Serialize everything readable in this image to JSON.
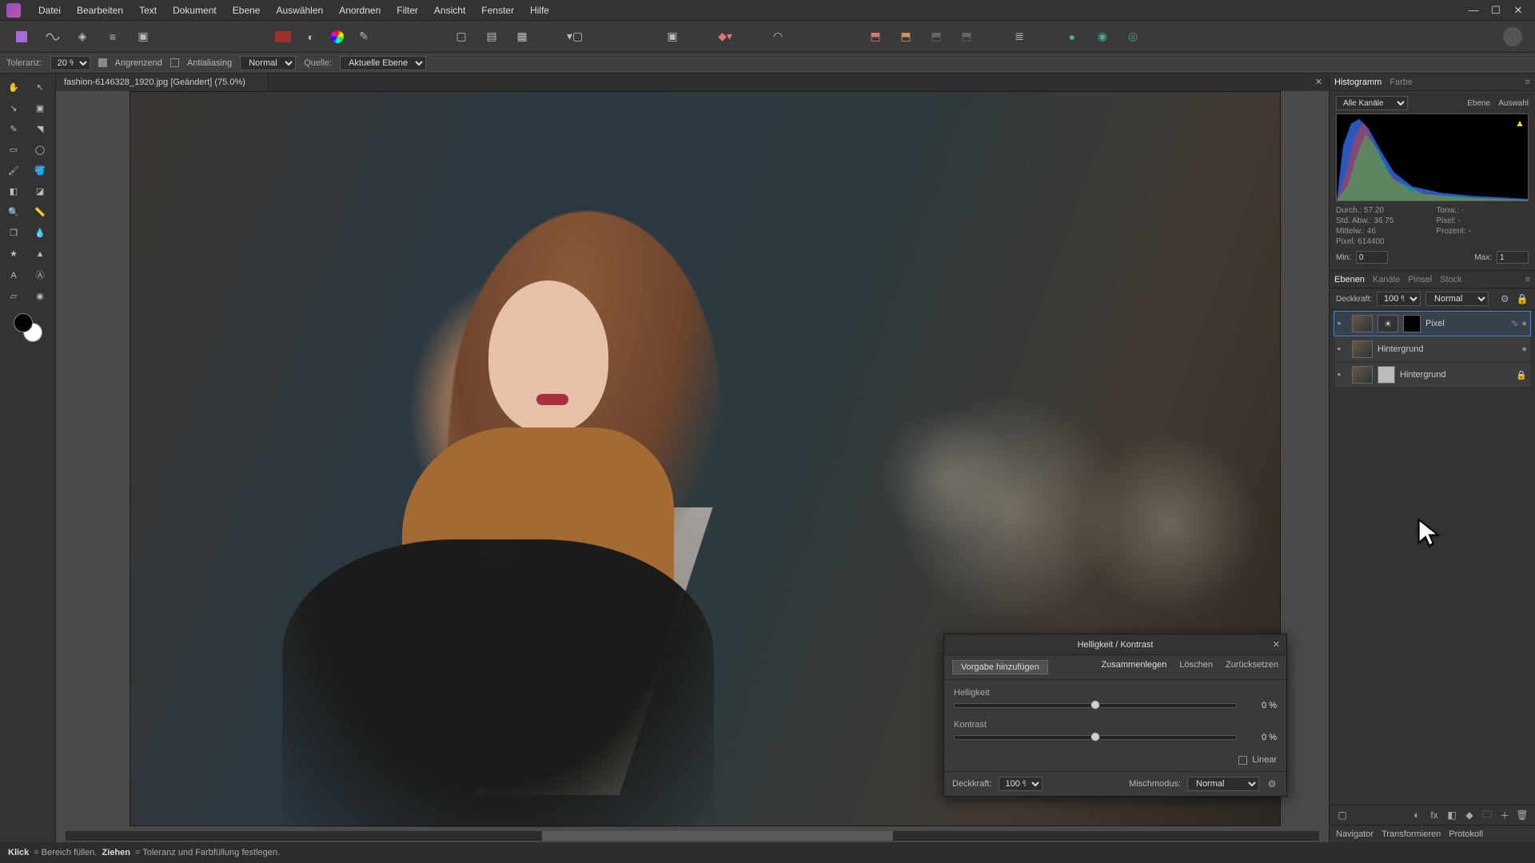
{
  "menu": {
    "items": [
      "Datei",
      "Bearbeiten",
      "Text",
      "Dokument",
      "Ebene",
      "Auswählen",
      "Anordnen",
      "Filter",
      "Ansicht",
      "Fenster",
      "Hilfe"
    ]
  },
  "contextbar": {
    "tolerance_label": "Toleranz:",
    "tolerance_value": "20 %",
    "contiguous": "Angrenzend",
    "antialias": "Antialiasing",
    "blend_mode": "Normal",
    "source_label": "Quelle:",
    "source_value": "Aktuelle Ebene"
  },
  "doc_tab": "fashion-6146328_1920.jpg [Geändert] (75.0%)",
  "right_top": {
    "tabs": [
      "Histogramm",
      "Farbe"
    ],
    "active": 0
  },
  "histogram": {
    "channels_label": "Alle Kanäle",
    "mode_tabs": [
      "Ebene",
      "Auswahl"
    ],
    "stats": {
      "durch": "Durch.: 57.20",
      "tonw": "Tonw.: -",
      "std": "Std. Abw.: 36.75",
      "pixel": "Pixel: -",
      "mittelw": "Mittelw.: 46",
      "prozent": "Prozent: -",
      "pixelcount": "Pixel: 614400"
    },
    "min_label": "Min:",
    "min": "0",
    "max_label": "Max:",
    "max": "1"
  },
  "layer_tabs": {
    "tabs": [
      "Ebenen",
      "Kanäle",
      "Pinsel",
      "Stock"
    ],
    "active": 0
  },
  "layers": {
    "opacity_label": "Deckkraft:",
    "opacity": "100 %",
    "blend": "Normal",
    "items": [
      {
        "name": "Pixel",
        "selected": true,
        "mask": "dark",
        "adj": true
      },
      {
        "name": "Hintergrund",
        "mask": "light"
      },
      {
        "name": "Hintergrund",
        "locked": true,
        "mask": "light"
      }
    ]
  },
  "dialog": {
    "title": "Helligkeit / Kontrast",
    "preset": "Vorgabe hinzufügen",
    "merge": "Zusammenlegen",
    "delete": "Löschen",
    "reset": "Zurücksetzen",
    "brightness_label": "Helligkeit",
    "brightness_val": "0 %",
    "contrast_label": "Kontrast",
    "contrast_val": "0 %",
    "linear": "Linear",
    "opacity_label": "Deckkraft:",
    "opacity": "100 %",
    "blend_label": "Mischmodus:",
    "blend": "Normal"
  },
  "bottom_tabs": [
    "Navigator",
    "Transformieren",
    "Protokoll"
  ],
  "status": {
    "klick": "Klick",
    "klick_txt": " = Bereich füllen. ",
    "ziehen": "Ziehen",
    "ziehen_txt": " = Toleranz und Farbfüllung festlegen."
  }
}
